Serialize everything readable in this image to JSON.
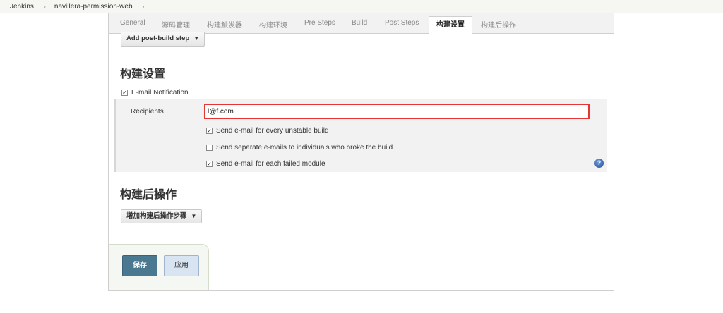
{
  "breadcrumb": {
    "items": [
      "Jenkins",
      "navillera-permission-web"
    ],
    "separator": "›"
  },
  "tabs": [
    {
      "label": "General"
    },
    {
      "label": "源码管理"
    },
    {
      "label": "构建触发器"
    },
    {
      "label": "构建环境"
    },
    {
      "label": "Pre Steps"
    },
    {
      "label": "Build"
    },
    {
      "label": "Post Steps"
    },
    {
      "label": "构建设置",
      "active": true
    },
    {
      "label": "构建后操作"
    }
  ],
  "post_build_step_button": {
    "label": "Add post-build step",
    "caret": "▼"
  },
  "build_settings": {
    "title": "构建设置",
    "email_notification": {
      "checked": true,
      "label": "E-mail Notification",
      "recipients_label": "Recipients",
      "recipients_value": "l@f.com",
      "options": [
        {
          "label": "Send e-mail for every unstable build",
          "checked": true
        },
        {
          "label": "Send separate e-mails to individuals who broke the build",
          "checked": false
        },
        {
          "label": "Send e-mail for each failed module",
          "checked": true
        }
      ]
    },
    "help_icon": "?"
  },
  "post_build_actions": {
    "title": "构建后操作",
    "add_button": {
      "label": "增加构建后操作步骤",
      "caret": "▼"
    }
  },
  "footer": {
    "save_label": "保存",
    "apply_label": "应用"
  },
  "colors": {
    "highlight_border": "#e53535",
    "save_button": "#4a7890",
    "apply_button": "#d8e4f2",
    "help_icon": "#1f4f96"
  }
}
